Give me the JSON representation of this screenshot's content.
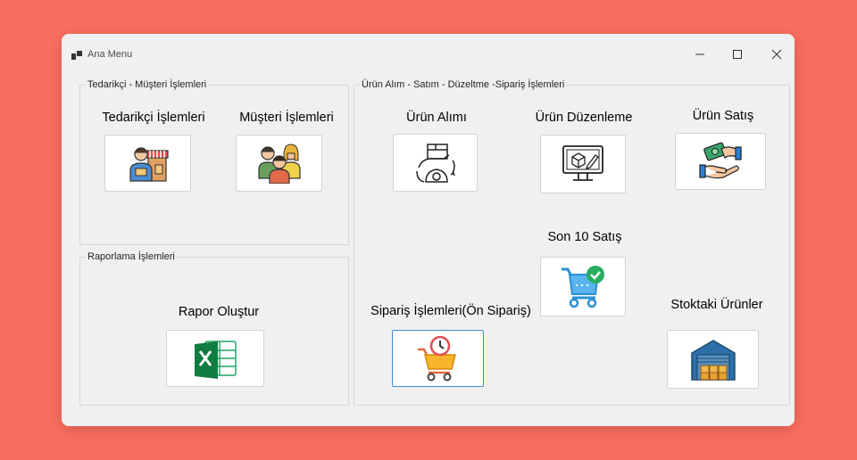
{
  "window": {
    "title": "Ana Menu"
  },
  "groups": {
    "supplier_customer": "Tedarikçi - Müşteri İşlemleri",
    "reporting": "Raporlama İşlemleri",
    "product": "Ürün Alım - Satım - Düzeltme -Sipariş  İşlemleri"
  },
  "labels": {
    "supplier": "Tedarikçi İşlemleri",
    "customer": "Müşteri İşlemleri",
    "report": "Rapor Oluştur",
    "purchase": "Ürün Alımı",
    "edit": "Ürün Düzenleme",
    "sale": "Ürün Satış",
    "last_sales": "Son 10 Satış",
    "order": "Sipariş İşlemleri(Ön Sipariş)",
    "stock": "Stoktaki Ürünler"
  },
  "icons": {
    "supplier": "supplier-shop-icon",
    "customer": "customer-group-icon",
    "report": "excel-icon",
    "purchase": "product-purchase-icon",
    "edit": "product-edit-monitor-icon",
    "sale": "money-hand-sale-icon",
    "last_sales": "cart-check-icon",
    "order": "cart-clock-icon",
    "stock": "warehouse-icon"
  },
  "colors": {
    "background": "#fa6e5f",
    "window": "#f0f0f0",
    "focus": "#3c8fd6"
  }
}
